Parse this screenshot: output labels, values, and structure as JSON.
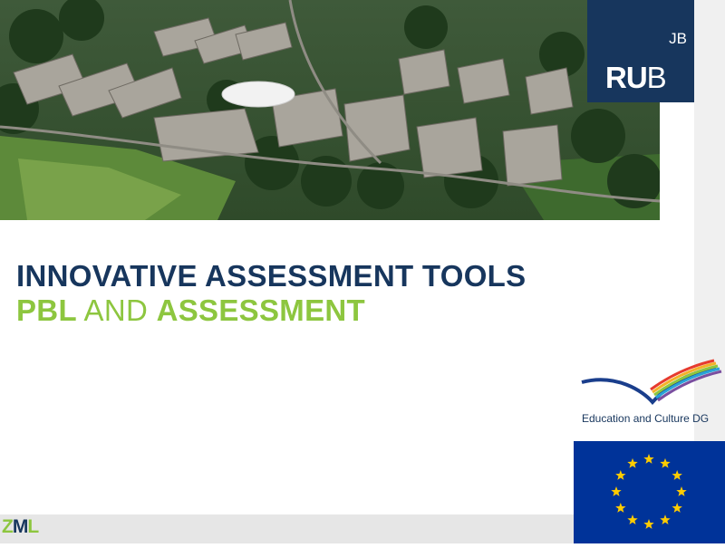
{
  "colors": {
    "navy": "#17365d",
    "green": "#8dc63f",
    "eu_blue": "#003399",
    "eu_gold": "#ffcc00"
  },
  "header": {
    "photo": "campus-aerial-photo",
    "logo": {
      "mini_text": "JB",
      "main_prefix": "RU",
      "main_suffix": "B"
    }
  },
  "title": {
    "line1": "INNOVATIVE ASSESSMENT TOOLS",
    "line2_a": "PBL",
    "line2_b": " AND ",
    "line2_c": "ASSESSMENT"
  },
  "eu": {
    "caption": "Education and Culture DG",
    "flag_icon": "eu-flag-icon"
  },
  "footer": {
    "logo_a": "Z",
    "logo_b": "M",
    "logo_c": "L"
  }
}
